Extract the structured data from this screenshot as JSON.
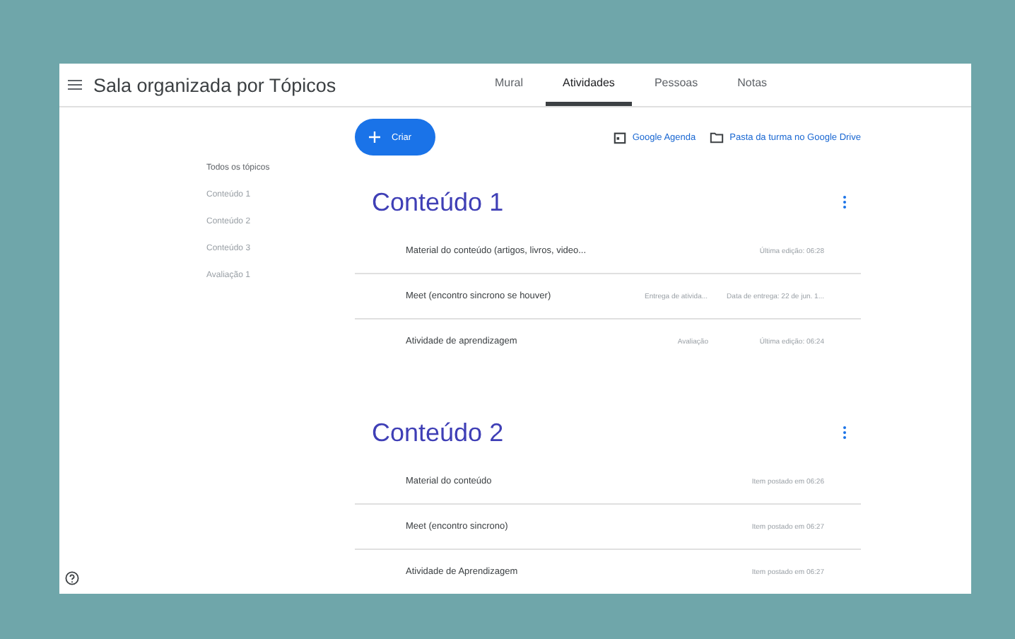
{
  "header": {
    "title": "Sala organizada por Tópicos",
    "tabs": [
      {
        "label": "Mural",
        "selected": false
      },
      {
        "label": "Atividades",
        "selected": true
      },
      {
        "label": "Pessoas",
        "selected": false
      },
      {
        "label": "Notas",
        "selected": false
      }
    ]
  },
  "toolbar": {
    "create": "Criar",
    "links": [
      {
        "kind": "calendar",
        "label": "Google Agenda"
      },
      {
        "kind": "folder",
        "label": "Pasta da turma no Google Drive"
      }
    ]
  },
  "topics": [
    {
      "label": "Todos os tópicos",
      "selected": true
    },
    {
      "label": "Conteúdo 1",
      "selected": false
    },
    {
      "label": "Conteúdo 2",
      "selected": false
    },
    {
      "label": "Conteúdo 3",
      "selected": false
    },
    {
      "label": "Avaliação 1",
      "selected": false
    }
  ],
  "sections": [
    {
      "title": "Conteúdo 1",
      "items": [
        {
          "title": "Material do conteúdo (artigos, livros, video...",
          "meta": "Última edição: 06:28"
        },
        {
          "title": "Meet (encontro sincrono se houver)",
          "tag": "Entrega de ativida...",
          "meta": "Data de entrega: 22 de jun. 1..."
        },
        {
          "title": "Atividade de aprendizagem",
          "tag": "Avaliação",
          "meta": "Última edição: 06:24"
        }
      ]
    },
    {
      "title": "Conteúdo 2",
      "items": [
        {
          "title": "Material do conteúdo",
          "meta": "Item postado em 06:26"
        },
        {
          "title": "Meet (encontro sincrono)",
          "meta": "Item postado em 06:27"
        },
        {
          "title": "Atividade de Aprendizagem",
          "meta": "Item postado em 06:27"
        }
      ]
    }
  ]
}
